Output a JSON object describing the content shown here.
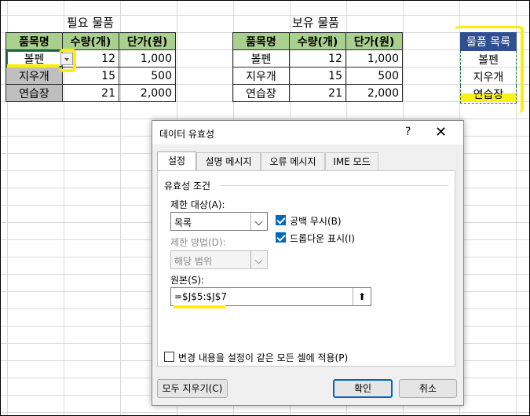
{
  "sheet": {
    "left_caption": "필요 물품",
    "right_caption": "보유 물품",
    "headers": [
      "품목명",
      "수량(개)",
      "단가(원)"
    ],
    "rows": [
      {
        "name": "볼펜",
        "qty": "12",
        "price": "1,000"
      },
      {
        "name": "지우개",
        "qty": "15",
        "price": "500"
      },
      {
        "name": "연습장",
        "qty": "21",
        "price": "2,000"
      }
    ],
    "list_header": "물품 목록",
    "list_items": [
      "볼펜",
      "지우개",
      "연습장"
    ],
    "colors": {
      "header_green": "#a9d08e",
      "list_header": "#2f4f8f",
      "highlight": "#ffee00",
      "selection": "#217346"
    }
  },
  "dialog": {
    "title": "데이터 유효성",
    "help_glyph": "?",
    "close_glyph": "✕",
    "tabs": [
      "설정",
      "설명 메시지",
      "오류 메시지",
      "IME 모드"
    ],
    "group_title": "유효성 조건",
    "allow_label": "제한 대상(A):",
    "allow_value": "목록",
    "data_label": "제한 방법(D):",
    "data_value": "해당 범위",
    "ignore_blank": "공백 무시(B)",
    "dropdown": "드롭다운 표시(I)",
    "source_label": "원본(S):",
    "source_value": "=$J$5:$J$7",
    "apply_all": "변경 내용을 설정이 같은 모든 셀에 적용(P)",
    "clear_all": "모두 지우기(C)",
    "ok": "확인",
    "cancel": "취소",
    "colors": {
      "accent": "#0067c0"
    }
  }
}
